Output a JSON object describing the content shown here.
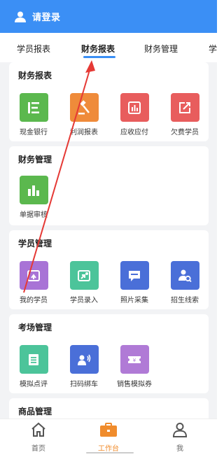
{
  "header": {
    "title": "请登录"
  },
  "tabs": [
    {
      "label": "学员报表"
    },
    {
      "label": "财务报表"
    },
    {
      "label": "财务管理"
    },
    {
      "label": "学"
    }
  ],
  "sections": [
    {
      "title": "财务报表",
      "items": [
        {
          "label": "现金银行",
          "icon": "cash-bank-icon",
          "color": "#5bb84e"
        },
        {
          "label": "利润报表",
          "icon": "hammer-icon",
          "color": "#ef8b3a"
        },
        {
          "label": "应收应付",
          "icon": "bar-report-icon",
          "color": "#e85d5d"
        },
        {
          "label": "欠费学员",
          "icon": "share-arrow-icon",
          "color": "#e85d5d"
        }
      ]
    },
    {
      "title": "财务管理",
      "items": [
        {
          "label": "单据审核",
          "icon": "bar-chart-icon",
          "color": "#5bb84e"
        }
      ]
    },
    {
      "title": "学员管理",
      "items": [
        {
          "label": "我的学员",
          "icon": "my-students-icon",
          "color": "#a873d6"
        },
        {
          "label": "学员录入",
          "icon": "student-entry-icon",
          "color": "#4cc49a"
        },
        {
          "label": "照片采集",
          "icon": "chat-icon",
          "color": "#4a6fd8"
        },
        {
          "label": "招生线索",
          "icon": "user-search-icon",
          "color": "#4a6fd8"
        }
      ]
    },
    {
      "title": "考场管理",
      "items": [
        {
          "label": "模拟点评",
          "icon": "document-icon",
          "color": "#4cc49a"
        },
        {
          "label": "扫码绑车",
          "icon": "voice-user-icon",
          "color": "#4a6fd8"
        },
        {
          "label": "销售模拟券",
          "icon": "coupon-icon",
          "color": "#b07ad6"
        }
      ]
    },
    {
      "title": "商品管理",
      "items": []
    }
  ],
  "bottom_nav": [
    {
      "label": "首页",
      "icon": "home-icon"
    },
    {
      "label": "工作台",
      "icon": "briefcase-icon"
    },
    {
      "label": "我",
      "icon": "person-icon"
    }
  ],
  "colors": {
    "primary": "#3b8ff5",
    "active_nav": "#f08c2c",
    "annotation_arrow": "#e53935"
  }
}
